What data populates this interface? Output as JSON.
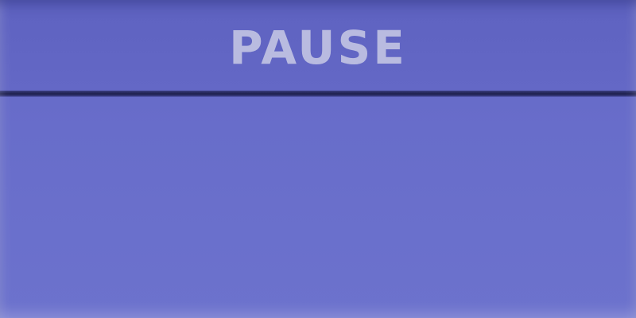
{
  "pause_menu": {
    "title": "PAUSE"
  },
  "colors": {
    "background": "#6a6fc8",
    "title_text": "#b9bbe0",
    "divider": "#1f2250"
  }
}
